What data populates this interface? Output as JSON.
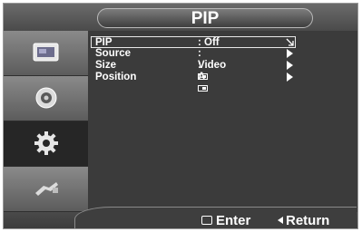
{
  "title": "PIP",
  "sidebar": {
    "items": [
      {
        "icon": "picture-icon",
        "active": false
      },
      {
        "icon": "sound-icon",
        "active": false
      },
      {
        "icon": "setup-gear-icon",
        "active": true
      },
      {
        "icon": "input-plug-icon",
        "active": false
      }
    ]
  },
  "menu": {
    "rows": [
      {
        "label": "PIP",
        "value": ": Off",
        "selected": true
      },
      {
        "label": "Source",
        "value": ": Video A",
        "selected": false
      },
      {
        "label": "Size",
        "value": ":",
        "selected": false
      },
      {
        "label": "Position",
        "value": ":",
        "selected": false
      }
    ]
  },
  "footer": {
    "enter_label": "Enter",
    "return_label": "Return"
  },
  "colors": {
    "background": "#3a3a3a",
    "text": "#ffffff",
    "active_tab": "#262626"
  }
}
